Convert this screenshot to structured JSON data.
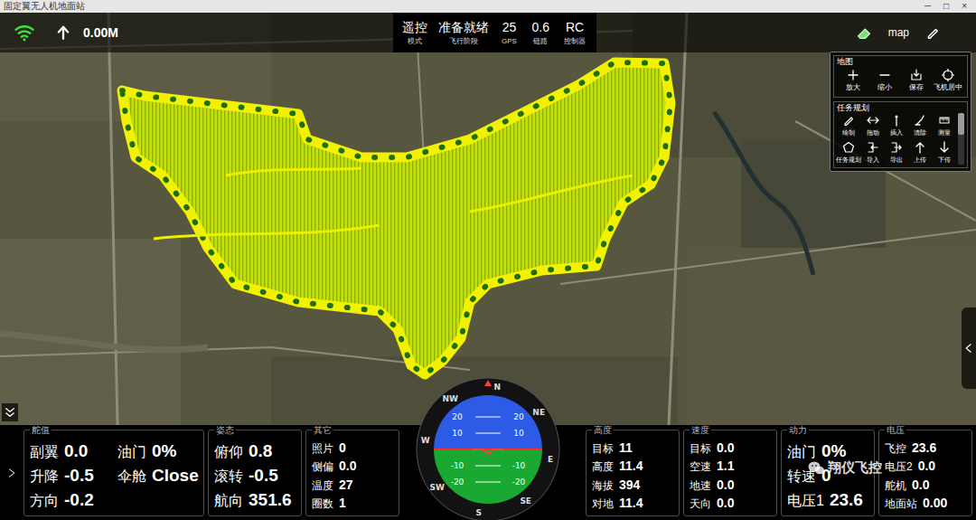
{
  "window": {
    "title": "固定翼无人机地面站",
    "controls": [
      "─",
      "□",
      "×"
    ]
  },
  "top_bar": {
    "distance": "0.00M",
    "status": [
      {
        "value": "遥控",
        "label": "模式"
      },
      {
        "value": "准备就绪",
        "label": "飞行阶段"
      },
      {
        "value": "25",
        "label": "GPS"
      },
      {
        "value": "0.6",
        "label": "链路"
      },
      {
        "value": "RC",
        "label": "控制器"
      }
    ],
    "map_button": "map"
  },
  "map_panel": {
    "title": "地图",
    "buttons": [
      "放大",
      "缩小",
      "保存",
      "飞机居中"
    ]
  },
  "mission_panel": {
    "title": "任务规划",
    "buttons": [
      "绘制",
      "拖动",
      "插入",
      "清除",
      "测量",
      "任务规划",
      "导入",
      "导出",
      "上传",
      "下传"
    ]
  },
  "panels": [
    {
      "title": "舵值",
      "kind": "wide",
      "rows": [
        {
          "label": "副翼",
          "value": "0.0"
        },
        {
          "label": "油门",
          "value": "0%"
        },
        {
          "label": "升降",
          "value": "-0.5"
        },
        {
          "label": "伞舱",
          "value": "Close"
        },
        {
          "label": "方向",
          "value": "-0.2"
        }
      ]
    },
    {
      "title": "姿态",
      "kind": "standard",
      "rows": [
        {
          "label": "俯仰",
          "value": "0.8"
        },
        {
          "label": "滚转",
          "value": "-0.5"
        },
        {
          "label": "航向",
          "value": "351.6"
        }
      ]
    },
    {
      "title": "其它",
      "kind": "compact",
      "rows": [
        {
          "label": "照片",
          "value": "0"
        },
        {
          "label": "侧偏",
          "value": "0.0"
        },
        {
          "label": "温度",
          "value": "27"
        },
        {
          "label": "圈数",
          "value": "1"
        }
      ]
    },
    {
      "title": "高度",
      "kind": "compact",
      "rows": [
        {
          "label": "目标",
          "value": "11"
        },
        {
          "label": "高度",
          "value": "11.4"
        },
        {
          "label": "海拔",
          "value": "394"
        },
        {
          "label": "对地",
          "value": "11.4"
        }
      ]
    },
    {
      "title": "速度",
      "kind": "compact",
      "rows": [
        {
          "label": "目标",
          "value": "0.0"
        },
        {
          "label": "空速",
          "value": "1.1"
        },
        {
          "label": "地速",
          "value": "0.0"
        },
        {
          "label": "天向",
          "value": "0.0"
        }
      ]
    },
    {
      "title": "动力",
      "kind": "standard",
      "rows": [
        {
          "label": "油门",
          "value": "0%"
        },
        {
          "label": "转速",
          "value": "0"
        },
        {
          "label": "电压1",
          "value": "23.6"
        }
      ]
    },
    {
      "title": "电压",
      "kind": "compact",
      "rows": [
        {
          "label": "飞控",
          "value": "23.6"
        },
        {
          "label": "电压2",
          "value": "0.0"
        },
        {
          "label": "舵机",
          "value": "0.0"
        },
        {
          "label": "地面站",
          "value": "0.00"
        }
      ]
    }
  ],
  "attitude_indicator": {
    "compass": [
      "N",
      "NE",
      "E",
      "SE",
      "S",
      "SW",
      "W",
      "NW"
    ],
    "pitch_labels": [
      "20",
      "10",
      "-10",
      "-20"
    ]
  },
  "watermark": "翔仪飞控"
}
